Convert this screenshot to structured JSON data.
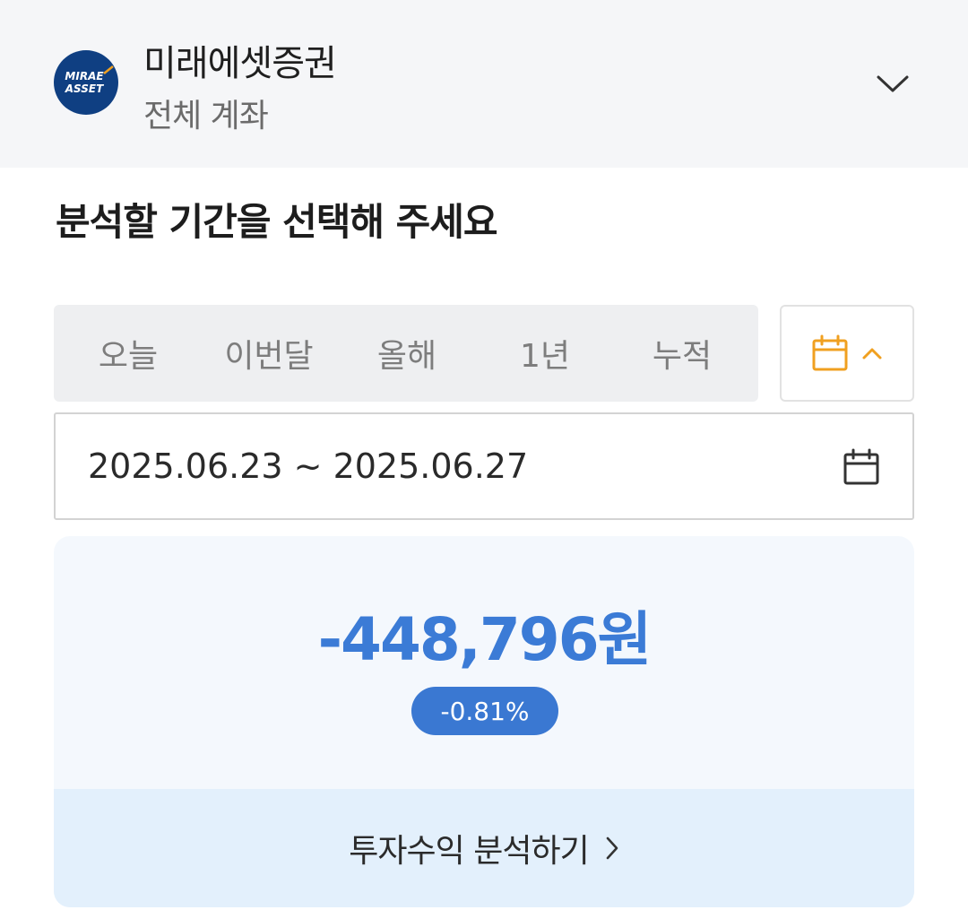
{
  "account": {
    "logo_text_top": "MIRAE",
    "logo_text_bottom": "ASSET",
    "broker_name": "미래에셋증권",
    "account_name": "전체 계좌"
  },
  "section": {
    "title": "분석할 기간을 선택해 주세요"
  },
  "period_tabs": [
    {
      "label": "오늘"
    },
    {
      "label": "이번달"
    },
    {
      "label": "올해"
    },
    {
      "label": "1년"
    },
    {
      "label": "누적"
    }
  ],
  "date_range": {
    "text": "2025.06.23 ~ 2025.06.27"
  },
  "result": {
    "amount": "-448,796원",
    "rate": "-0.81%",
    "analyze_label": "투자수익 분석하기"
  },
  "colors": {
    "accent_blue": "#3b7bd6",
    "badge_blue": "#3a78d2",
    "calendar_orange": "#f0a020",
    "card_bg": "#f4f8fd",
    "button_bg": "#e3f0fc"
  },
  "icons": {
    "account_toggle": "chevron-down-icon",
    "calendar_toggle": "calendar-icon",
    "calendar_collapse": "chevron-up-icon",
    "date_picker": "calendar-icon",
    "analyze_arrow": "chevron-right-icon"
  }
}
